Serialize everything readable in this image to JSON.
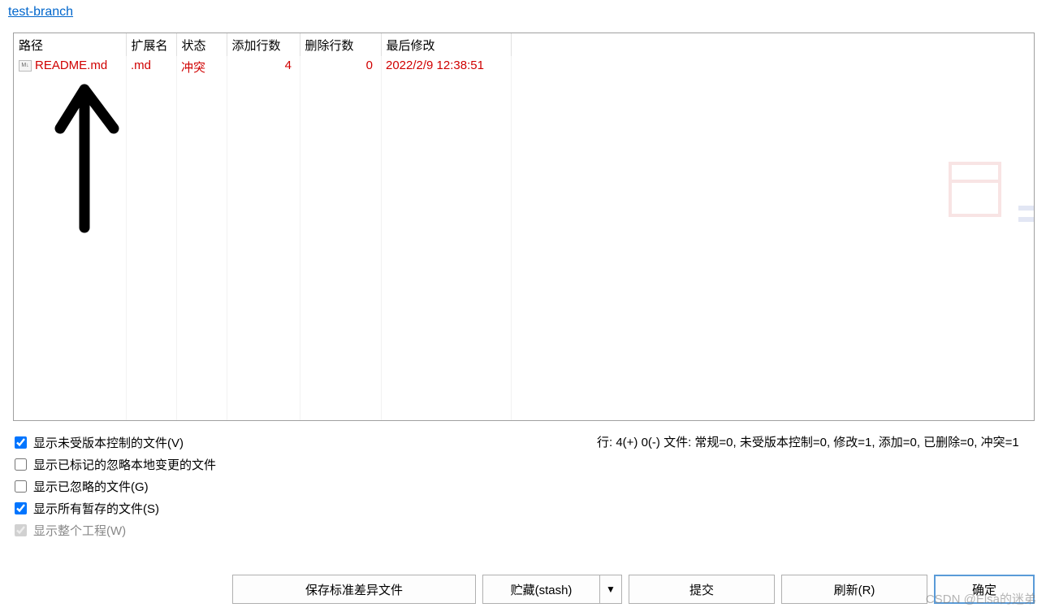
{
  "branch_link": "test-branch",
  "columns": {
    "path": "路径",
    "ext": "扩展名",
    "status": "状态",
    "add_lines": "添加行数",
    "del_lines": "删除行数",
    "last_mod": "最后修改"
  },
  "row": {
    "icon_label": "M↓",
    "filename": "README.md",
    "ext": ".md",
    "status": "冲突",
    "added": "4",
    "deleted": "0",
    "modified": "2022/2/9 12:38:51"
  },
  "options": {
    "show_unversioned": "显示未受版本控制的文件(V)",
    "show_marked_ignore": "显示已标记的忽略本地变更的文件",
    "show_ignored": "显示已忽略的文件(G)",
    "show_stashed": "显示所有暂存的文件(S)",
    "show_whole_project": "显示整个工程(W)"
  },
  "status_line": "行: 4(+) 0(-) 文件: 常规=0, 未受版本控制=0, 修改=1, 添加=0, 已删除=0, 冲突=1",
  "buttons": {
    "save_diff": "保存标准差异文件",
    "stash": "贮藏(stash)",
    "commit": "提交",
    "refresh": "刷新(R)",
    "ok": "确定"
  },
  "watermark": "CSDN @Elsa的迷弟"
}
